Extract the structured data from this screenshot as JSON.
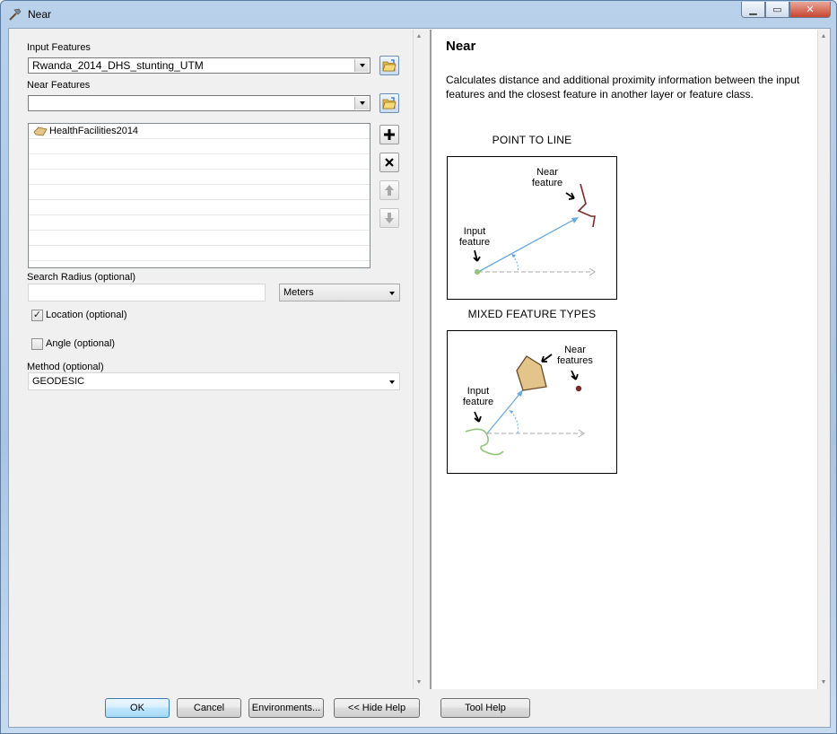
{
  "window": {
    "title": "Near"
  },
  "form": {
    "input_features": {
      "label": "Input Features",
      "value": "Rwanda_2014_DHS_stunting_UTM"
    },
    "near_features": {
      "label": "Near Features",
      "value": "",
      "items": [
        "HealthFacilities2014",
        "",
        "",
        "",
        "",
        "",
        "",
        "",
        ""
      ]
    },
    "search_radius": {
      "label": "Search Radius (optional)",
      "value": "",
      "unit": "Meters"
    },
    "location": {
      "label": "Location (optional)",
      "checked": true
    },
    "angle": {
      "label": "Angle (optional)",
      "checked": false
    },
    "method": {
      "label": "Method (optional)",
      "value": "GEODESIC"
    }
  },
  "help": {
    "title": "Near",
    "description": "Calculates distance and additional proximity information between the input features and the closest feature in another layer or feature class.",
    "figure1": {
      "caption": "POINT TO LINE",
      "near_label_1": "Near",
      "near_label_2": "feature",
      "input_label_1": "Input",
      "input_label_2": "feature"
    },
    "figure2": {
      "caption": "MIXED FEATURE TYPES",
      "near_label_1": "Near",
      "near_label_2": "features",
      "input_label_1": "Input",
      "input_label_2": "feature"
    }
  },
  "buttons": {
    "ok": "OK",
    "cancel": "Cancel",
    "environments": "Environments...",
    "hide_help": "<< Hide Help",
    "tool_help": "Tool Help"
  },
  "icons": {
    "title": "hammer-icon",
    "browse": "open-folder-icon",
    "add": "plus-icon",
    "remove": "x-icon",
    "up": "arrow-up-icon",
    "down": "arrow-down-icon",
    "layer": "polygon-layer-icon"
  },
  "colors": {
    "arrow_blue": "#6aa9dc",
    "line_brown": "#7a2a2a",
    "polygon_fill": "#e3c48a",
    "point_green": "#93c47d"
  }
}
